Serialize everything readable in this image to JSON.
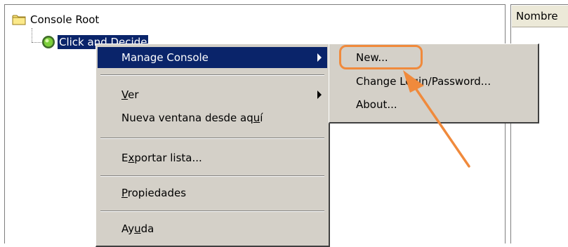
{
  "tree": {
    "root_label": "Console Root",
    "selected_node_label": "Click and Decide"
  },
  "list": {
    "column_header": "Nombre"
  },
  "context_menu": {
    "items": [
      {
        "label": "Manage Console",
        "has_submenu": true,
        "highlighted": true
      },
      {
        "label_pre": "",
        "label_u": "V",
        "label_post": "er",
        "has_submenu": true
      },
      {
        "label_pre": "Nueva ventana desde aq",
        "label_u": "u",
        "label_post": "í"
      },
      {
        "label_pre": "E",
        "label_u": "x",
        "label_post": "portar lista..."
      },
      {
        "label_pre": "",
        "label_u": "P",
        "label_post": "ropiedades"
      },
      {
        "label_pre": "Ay",
        "label_u": "u",
        "label_post": "da"
      }
    ]
  },
  "submenu": {
    "items": [
      {
        "label": "New..."
      },
      {
        "label": "Change Login/Password..."
      },
      {
        "label": "About..."
      }
    ]
  },
  "annotation": {
    "highlight_color": "#f08a3c",
    "selection_color": "#0a246a",
    "menu_bg": "#d4d0c8"
  }
}
